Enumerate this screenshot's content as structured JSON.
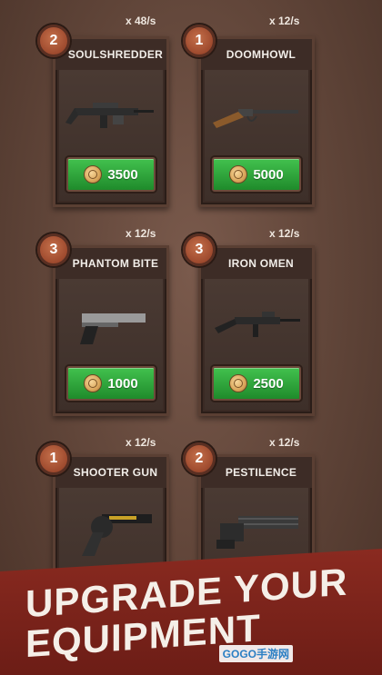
{
  "cards": [
    {
      "name": "SOULSHREDDER",
      "level": "2",
      "rate": "x 48/s",
      "price": "3500",
      "weapon_icon": "machine-gun-icon"
    },
    {
      "name": "DOOMHOWL",
      "level": "1",
      "rate": "x 12/s",
      "price": "5000",
      "weapon_icon": "lever-rifle-icon"
    },
    {
      "name": "PHANTOM BITE",
      "level": "3",
      "rate": "x 12/s",
      "price": "1000",
      "weapon_icon": "pistol-icon"
    },
    {
      "name": "IRON OMEN",
      "level": "3",
      "rate": "x 12/s",
      "price": "2500",
      "weapon_icon": "assault-rifle-icon"
    },
    {
      "name": "SHOOTER GUN",
      "level": "1",
      "rate": "x 12/s",
      "weapon_icon": "revolver-icon"
    },
    {
      "name": "PESTILENCE",
      "level": "2",
      "rate": "x 12/s",
      "weapon_icon": "minigun-icon"
    }
  ],
  "banner": {
    "line1": "UPGRADE YOUR",
    "line2": "EQUIPMENT"
  },
  "watermark": "GOGO手游网"
}
